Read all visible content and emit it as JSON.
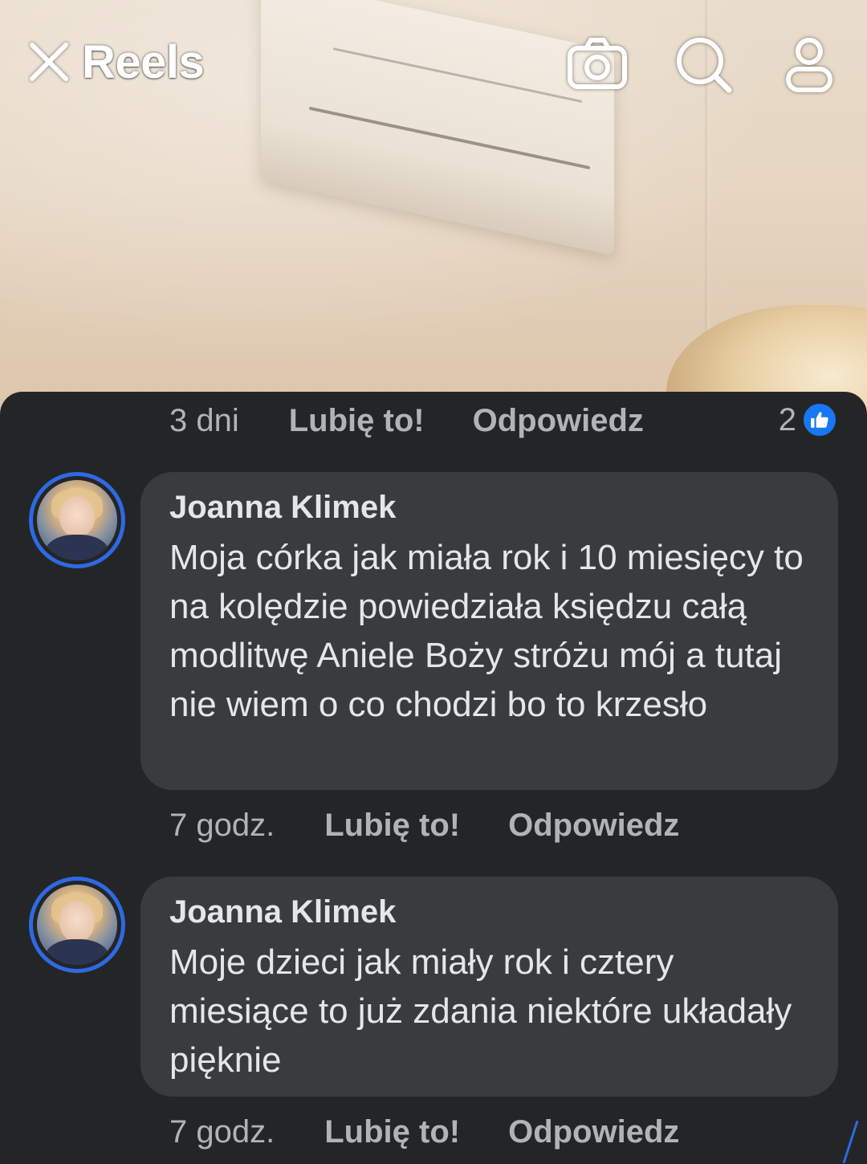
{
  "header": {
    "title": "Reels",
    "icons": [
      "close-icon",
      "camera-icon",
      "search-icon",
      "profile-icon"
    ]
  },
  "previous_comment_actions": {
    "time": "3 dni",
    "like": "Lubię to!",
    "reply": "Odpowiedz",
    "reaction_count": "2",
    "reaction_icon": "thumbs-up-icon"
  },
  "comments": [
    {
      "author": "Joanna Klimek",
      "text": "Moja córka jak miała rok i 10 miesięcy to na kolędzie powiedziała księdzu całą modlitwę Aniele Boży stróżu mój a tutaj nie wiem o co chodzi bo to krzesło",
      "time": "7 godz.",
      "like": "Lubię to!",
      "reply": "Odpowiedz"
    },
    {
      "author": "Joanna Klimek",
      "text": "Moje dzieci jak miały rok i cztery miesiące to już zdania niektóre układały pięknie",
      "time": "7 godz.",
      "like": "Lubię to!",
      "reply": "Odpowiedz"
    }
  ],
  "colors": {
    "sheet_bg": "#242526",
    "bubble_bg": "#3a3b3c",
    "text_primary": "#e4e6eb",
    "text_secondary": "#b0b3b8",
    "accent": "#1877f2",
    "avatar_ring": "#2d6ae3"
  }
}
